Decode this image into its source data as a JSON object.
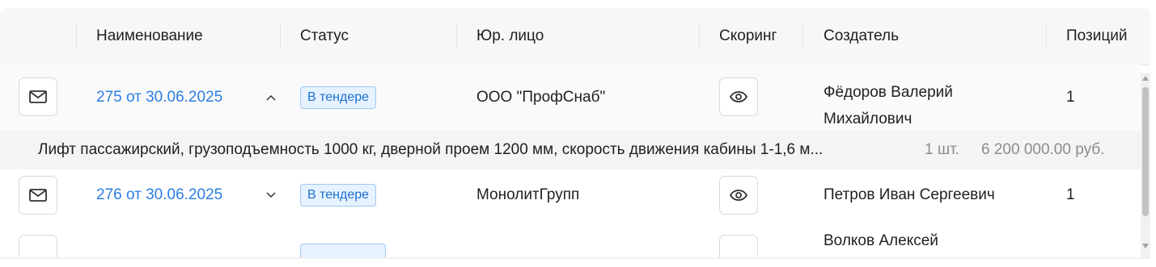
{
  "columns": {
    "name": "Наименование",
    "status": "Статус",
    "legal": "Юр. лицо",
    "scoring": "Скоринг",
    "creator": "Создатель",
    "positions": "Позиций"
  },
  "rows": [
    {
      "name": "275 от 30.06.2025",
      "status": "В тендере",
      "legal": "ООО \"ПрофСнаб\"",
      "creator_line1": "Фёдоров Валерий",
      "creator_line2": "Михайлович",
      "positions": "1",
      "expanded": true,
      "item": {
        "description": "Лифт пассажирский, грузоподъемность 1000 кг, дверной проем 1200 мм, скорость движения кабины 1-1,6 м...",
        "quantity": "1 шт.",
        "price": "6 200 000.00 руб."
      }
    },
    {
      "name": "276 от 30.06.2025",
      "status": "В тендере",
      "legal": "МонолитГрупп",
      "creator": "Петров Иван Сергеевич",
      "positions": "1",
      "expanded": false
    },
    {
      "creator_line1": "Волков Алексей"
    }
  ],
  "icons": {
    "mail": "mail-icon",
    "eye": "eye-icon",
    "chevron_up": "chevron-up-icon",
    "chevron_down": "chevron-down-icon"
  }
}
